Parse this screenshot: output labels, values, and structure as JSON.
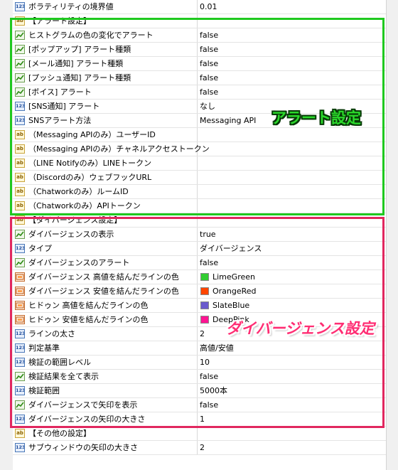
{
  "rows": [
    {
      "icon": "num",
      "name": "ボラティリティの境界値",
      "value": "0.01"
    },
    {
      "icon": "ab",
      "name": "【アラート設定】",
      "value": ""
    },
    {
      "icon": "bool",
      "name": "ヒストグラムの色の変化でアラート",
      "value": "false"
    },
    {
      "icon": "bool",
      "name": "[ポップアップ] アラート種類",
      "value": "false"
    },
    {
      "icon": "bool",
      "name": "[メール通知] アラート種類",
      "value": "false"
    },
    {
      "icon": "bool",
      "name": "[プッシュ通知] アラート種類",
      "value": "false"
    },
    {
      "icon": "bool",
      "name": "[ボイス] アラート",
      "value": "false"
    },
    {
      "icon": "num",
      "name": "[SNS通知] アラート",
      "value": "なし"
    },
    {
      "icon": "num",
      "name": "SNSアラート方法",
      "value": "Messaging API"
    },
    {
      "icon": "ab",
      "name": "（Messaging APIのみ）ユーザーID",
      "value": ""
    },
    {
      "icon": "ab",
      "name": "（Messaging APIのみ）チャネルアクセストークン",
      "value": ""
    },
    {
      "icon": "ab",
      "name": "（LINE Notifyのみ）LINEトークン",
      "value": ""
    },
    {
      "icon": "ab",
      "name": "（Discordのみ）ウェブフックURL",
      "value": ""
    },
    {
      "icon": "ab",
      "name": "（Chatworkのみ）ルームID",
      "value": ""
    },
    {
      "icon": "ab",
      "name": "（Chatworkのみ）APIトークン",
      "value": ""
    },
    {
      "icon": "ab",
      "name": "【ダイバージェンス設定】",
      "value": ""
    },
    {
      "icon": "bool",
      "name": "ダイバージェンスの表示",
      "value": "true"
    },
    {
      "icon": "num",
      "name": "タイプ",
      "value": "ダイバージェンス"
    },
    {
      "icon": "bool",
      "name": "ダイバージェンスのアラート",
      "value": "false"
    },
    {
      "icon": "color",
      "name": "ダイバージェンス 高値を結んだラインの色",
      "value": "LimeGreen",
      "swatch": "#32cd32"
    },
    {
      "icon": "color",
      "name": "ダイバージェンス 安値を結んだラインの色",
      "value": "OrangeRed",
      "swatch": "#ff4500"
    },
    {
      "icon": "color",
      "name": "ヒドゥン 高値を結んだラインの色",
      "value": "SlateBlue",
      "swatch": "#6a5acd"
    },
    {
      "icon": "color",
      "name": "ヒドゥン 安値を結んだラインの色",
      "value": "DeepPink",
      "swatch": "#ff1493"
    },
    {
      "icon": "num",
      "name": "ラインの太さ",
      "value": "2"
    },
    {
      "icon": "num",
      "name": "判定基準",
      "value": "高値/安値"
    },
    {
      "icon": "num",
      "name": "検証の範囲レベル",
      "value": "10"
    },
    {
      "icon": "bool",
      "name": "検証結果を全て表示",
      "value": "false"
    },
    {
      "icon": "num",
      "name": "検証範囲",
      "value": "5000本"
    },
    {
      "icon": "bool",
      "name": "ダイバージェンスで矢印を表示",
      "value": "false"
    },
    {
      "icon": "num",
      "name": "ダイバージェンスの矢印の大きさ",
      "value": "1"
    },
    {
      "icon": "ab",
      "name": "【その他の設定】",
      "value": ""
    },
    {
      "icon": "num",
      "name": "サブウィンドウの矢印の大きさ",
      "value": "2"
    }
  ],
  "annotations": {
    "alert_section": "アラート設定",
    "divergence_section": "ダイバージェンス設定",
    "green_color": "#1fc91f",
    "pink_color": "#e1275f"
  }
}
